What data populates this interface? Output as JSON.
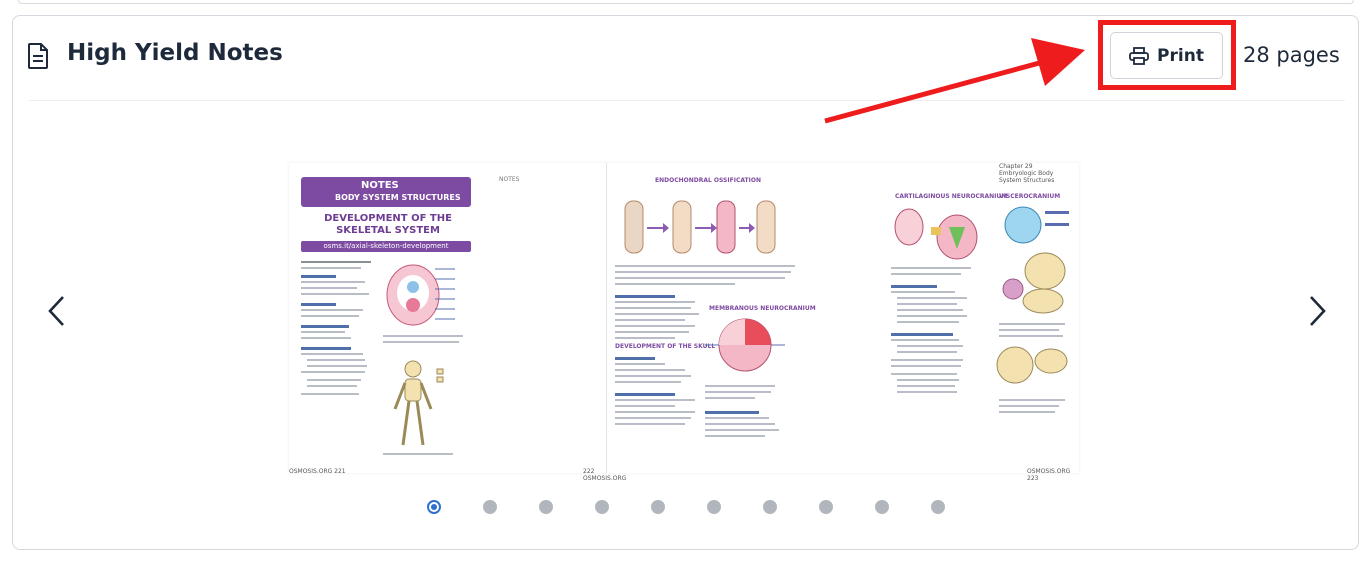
{
  "header": {
    "title": "High Yield Notes",
    "print_label": "Print",
    "pages_count": "28 pages",
    "icon": "document-icon"
  },
  "preview": {
    "left_page": {
      "banner_title": "NOTES",
      "banner_subtitle": "BODY SYSTEM STRUCTURES",
      "title": "DEVELOPMENT OF THE SKELETAL SYSTEM",
      "url": "osms.it/axial-skeleton-development",
      "footer": "OSMOSIS.ORG  221"
    },
    "middle_page": {
      "notes_label": "NOTES",
      "footer": "222  OSMOSIS.ORG"
    },
    "right_page": {
      "chapter_label": "Chapter 29 Embryologic Body System Structures",
      "section_endochondral": "ENDOCHONDRAL OSSIFICATION",
      "section_membranous": "MEMBRANOUS NEUROCRANIUM",
      "section_skull": "DEVELOPMENT OF THE SKULL",
      "section_cartilaginous": "CARTILAGINOUS NEUROCRANIUM",
      "section_viscerocranium": "VISCEROCRANIUM",
      "footer": "OSMOSIS.ORG  223"
    }
  },
  "pagination": {
    "dot_count": 10,
    "active_index": 0
  },
  "colors": {
    "highlight": "#ee1c1c",
    "accent_purple": "#7e4ba2",
    "active_dot": "#2f6fd1",
    "inactive_dot": "#b1b6bd"
  }
}
